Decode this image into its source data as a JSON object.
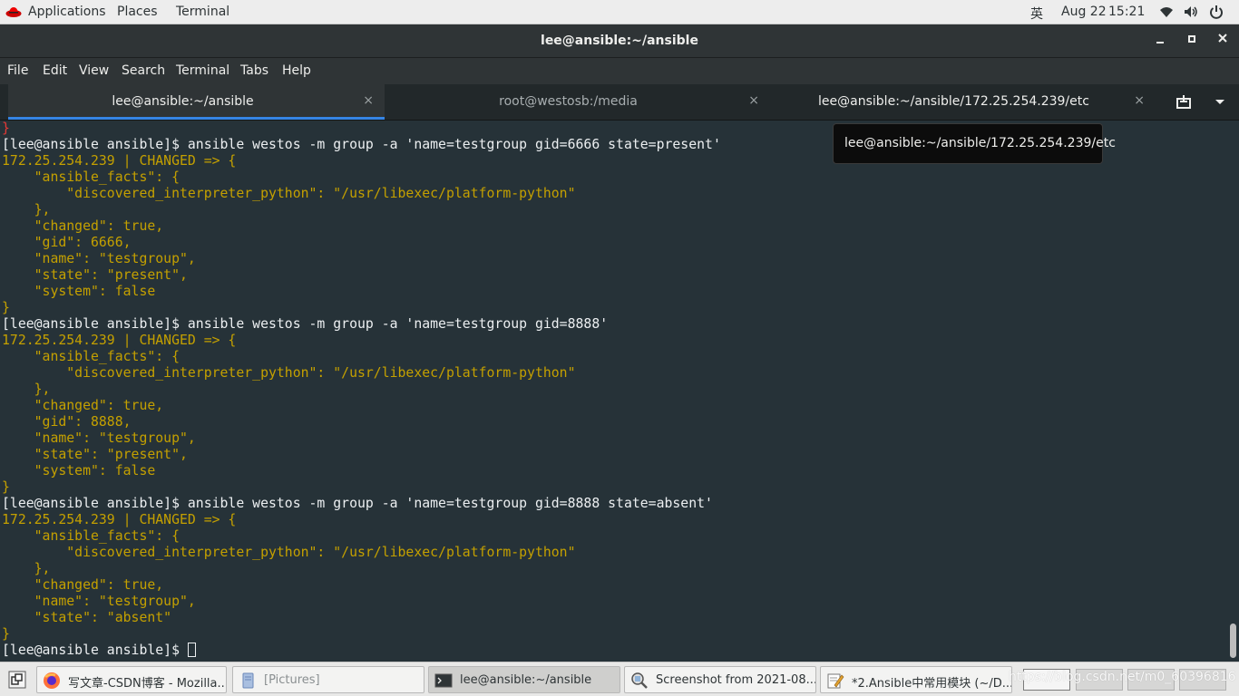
{
  "topbar": {
    "applications": "Applications",
    "places": "Places",
    "terminal": "Terminal",
    "input_method": "英",
    "date": "Aug 22",
    "time": "15:21"
  },
  "window": {
    "title": "lee@ansible:~/ansible"
  },
  "menu": [
    "File",
    "Edit",
    "View",
    "Search",
    "Terminal",
    "Tabs",
    "Help"
  ],
  "tabs": [
    {
      "label": "lee@ansible:~/ansible",
      "close": "×",
      "active": true
    },
    {
      "label": "root@westosb:/media",
      "close": "×",
      "active": false
    },
    {
      "label": "lee@ansible:~/ansible/172.25.254.239/etc",
      "close": "×",
      "active": false
    }
  ],
  "tooltip": "lee@ansible:~/ansible/172.25.254.239/etc",
  "terminal_lines": [
    {
      "t": "}",
      "c": "red"
    },
    {
      "t": "[lee@ansible ansible]$ ansible westos -m group -a 'name=testgroup gid=6666 state=present'",
      "c": "prompt"
    },
    {
      "t": "172.25.254.239 | CHANGED => {",
      "c": "out"
    },
    {
      "t": "    \"ansible_facts\": {",
      "c": "out"
    },
    {
      "t": "        \"discovered_interpreter_python\": \"/usr/libexec/platform-python\"",
      "c": "out"
    },
    {
      "t": "    },",
      "c": "out"
    },
    {
      "t": "    \"changed\": true,",
      "c": "out"
    },
    {
      "t": "    \"gid\": 6666,",
      "c": "out"
    },
    {
      "t": "    \"name\": \"testgroup\",",
      "c": "out"
    },
    {
      "t": "    \"state\": \"present\",",
      "c": "out"
    },
    {
      "t": "    \"system\": false",
      "c": "out"
    },
    {
      "t": "}",
      "c": "out"
    },
    {
      "t": "[lee@ansible ansible]$ ansible westos -m group -a 'name=testgroup gid=8888'",
      "c": "prompt"
    },
    {
      "t": "172.25.254.239 | CHANGED => {",
      "c": "out"
    },
    {
      "t": "    \"ansible_facts\": {",
      "c": "out"
    },
    {
      "t": "        \"discovered_interpreter_python\": \"/usr/libexec/platform-python\"",
      "c": "out"
    },
    {
      "t": "    },",
      "c": "out"
    },
    {
      "t": "    \"changed\": true,",
      "c": "out"
    },
    {
      "t": "    \"gid\": 8888,",
      "c": "out"
    },
    {
      "t": "    \"name\": \"testgroup\",",
      "c": "out"
    },
    {
      "t": "    \"state\": \"present\",",
      "c": "out"
    },
    {
      "t": "    \"system\": false",
      "c": "out"
    },
    {
      "t": "}",
      "c": "out"
    },
    {
      "t": "[lee@ansible ansible]$ ansible westos -m group -a 'name=testgroup gid=8888 state=absent'",
      "c": "prompt"
    },
    {
      "t": "172.25.254.239 | CHANGED => {",
      "c": "out"
    },
    {
      "t": "    \"ansible_facts\": {",
      "c": "out"
    },
    {
      "t": "        \"discovered_interpreter_python\": \"/usr/libexec/platform-python\"",
      "c": "out"
    },
    {
      "t": "    },",
      "c": "out"
    },
    {
      "t": "    \"changed\": true,",
      "c": "out"
    },
    {
      "t": "    \"name\": \"testgroup\",",
      "c": "out"
    },
    {
      "t": "    \"state\": \"absent\"",
      "c": "out"
    },
    {
      "t": "}",
      "c": "out"
    }
  ],
  "prompt_line": "[lee@ansible ansible]$ ",
  "taskbar": {
    "tasks": [
      {
        "label": "写文章-CSDN博客 - Mozilla...",
        "icon": "firefox-icon"
      },
      {
        "label": "[Pictures]",
        "icon": "folder-icon"
      },
      {
        "label": "lee@ansible:~/ansible",
        "icon": "terminal-icon"
      },
      {
        "label": "Screenshot from 2021-08...",
        "icon": "image-viewer-icon"
      },
      {
        "label": "*2.Ansible中常用模块 (~/D...",
        "icon": "text-editor-icon"
      }
    ],
    "watermark": "https://blog.csdn.net/m0_60396816"
  },
  "colors": {
    "terminal_bg": "#263238",
    "output_yellow": "#c4a000",
    "tab_accent": "#3584e4"
  }
}
